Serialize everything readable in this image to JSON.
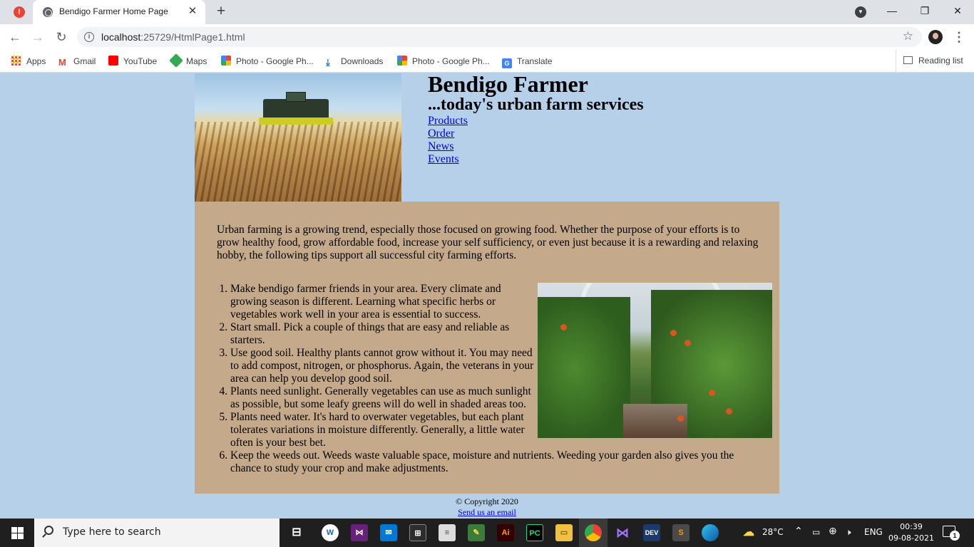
{
  "browser": {
    "tab_title": "Bendigo Farmer Home Page",
    "url_host": "localhost",
    "url_rest": ":25729/HtmlPage1.html",
    "bookmarks": [
      {
        "label": "Apps",
        "icon": "apps-grid-icon"
      },
      {
        "label": "Gmail",
        "icon": "gmail-icon"
      },
      {
        "label": "YouTube",
        "icon": "youtube-icon"
      },
      {
        "label": "Maps",
        "icon": "maps-icon"
      },
      {
        "label": "Photo - Google Ph...",
        "icon": "google-photos-icon"
      },
      {
        "label": "Downloads",
        "icon": "download-icon"
      },
      {
        "label": "Photo - Google Ph...",
        "icon": "google-photos-icon"
      },
      {
        "label": "Translate",
        "icon": "google-translate-icon"
      }
    ],
    "reading_list": "Reading list"
  },
  "page": {
    "title": "Bendigo Farmer",
    "subtitle": "...today's urban farm services",
    "nav": [
      "Products",
      "Order",
      "News",
      "Events"
    ],
    "intro": "Urban farming is a growing trend, especially those focused on growing food. Whether the purpose of your efforts is to grow healthy food, grow affordable food, increase your self sufficiency, or even just because it is a rewarding and relaxing hobby, the following tips support all successful city farming efforts.",
    "tips": [
      "Make bendigo farmer friends in your area. Every climate and growing season is different. Learning what specific herbs or vegetables work well in your area is essential to success.",
      "Start small. Pick a couple of things that are easy and reliable as starters.",
      "Use good soil. Healthy plants cannot grow without it. You may need to add compost, nitrogen, or phosphorus. Again, the veterans in your area can help you develop good soil.",
      "Plants need sunlight. Generally vegetables can use as much sunlight as possible, but some leafy greens will do well in shaded areas too.",
      "Plants need water. It's hard to overwater vegetables, but each plant tolerates variations in moisture differently. Generally, a little water often is your best bet.",
      "Keep the weeds out. Weeds waste valuable space, moisture and nutrients. Weeding your garden also gives you the chance to study your crop and make adjustments."
    ],
    "copyright": "© Copyright 2020",
    "email_link": "Send us an email"
  },
  "colors": {
    "page_background": "#b6d0e9",
    "content_background": "#c4a98a",
    "link": "#0000ee"
  },
  "taskbar": {
    "search_placeholder": "Type here to search",
    "temperature": "28°C",
    "language": "ENG",
    "time": "00:39",
    "date": "09-08-2021",
    "notification_count": "1"
  }
}
